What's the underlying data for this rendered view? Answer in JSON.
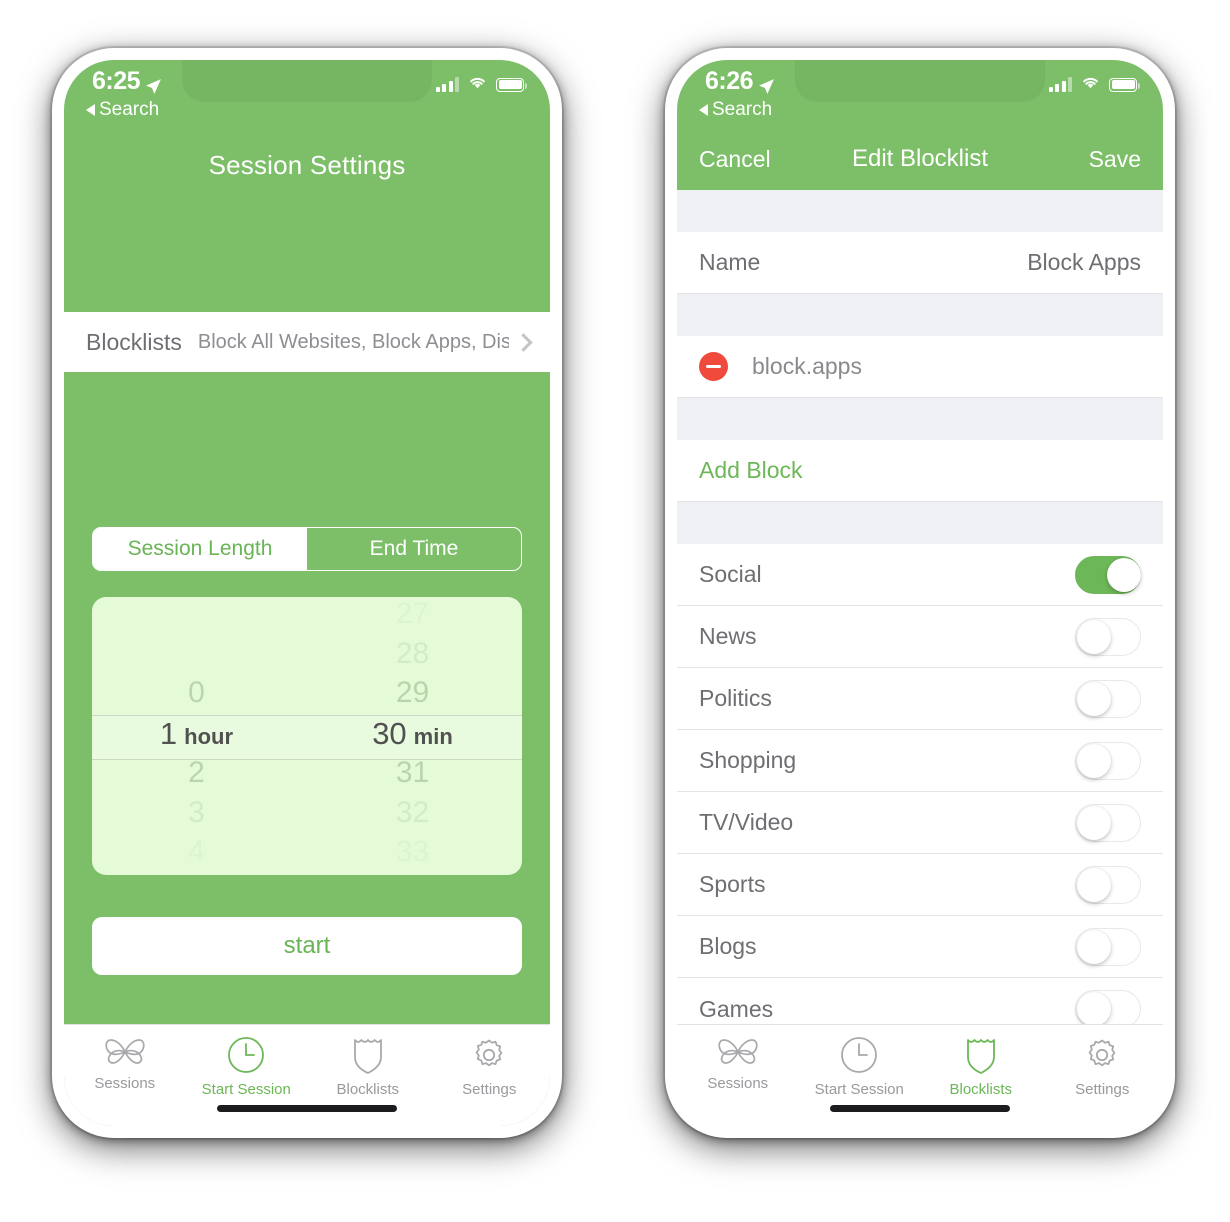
{
  "left_phone": {
    "status_bar": {
      "time": "6:25",
      "back_label": "Search",
      "location_icon": "location-arrow-icon",
      "signal_icon": "cellular-signal-icon",
      "wifi_icon": "wifi-icon",
      "battery_icon": "battery-icon"
    },
    "title": "Session Settings",
    "blocklists_row": {
      "label": "Blocklists",
      "value": "Block All Websites, Block Apps, Distra…",
      "chevron_icon": "chevron-right-icon"
    },
    "segmented_control": {
      "options": [
        "Session Length",
        "End Time"
      ],
      "selected_index": 0
    },
    "picker": {
      "hours": {
        "items": [
          "0",
          "1",
          "2",
          "3",
          "4"
        ],
        "selected": "1",
        "unit": "hour",
        "selected_index": 1
      },
      "minutes": {
        "items": [
          "27",
          "28",
          "29",
          "30",
          "31",
          "32",
          "33"
        ],
        "selected": "30",
        "unit": "min",
        "selected_index": 3
      }
    },
    "start_button": "start",
    "tab_bar": {
      "items": [
        {
          "label": "Sessions",
          "icon": "butterfly-icon",
          "active": false
        },
        {
          "label": "Start Session",
          "icon": "clock-icon",
          "active": true
        },
        {
          "label": "Blocklists",
          "icon": "shield-icon",
          "active": false
        },
        {
          "label": "Settings",
          "icon": "gear-icon",
          "active": false
        }
      ]
    }
  },
  "right_phone": {
    "status_bar": {
      "time": "6:26",
      "back_label": "Search",
      "location_icon": "location-arrow-icon",
      "signal_icon": "cellular-signal-icon",
      "wifi_icon": "wifi-icon",
      "battery_icon": "battery-icon"
    },
    "nav_bar": {
      "cancel": "Cancel",
      "title": "Edit Blocklist",
      "save": "Save"
    },
    "name_row": {
      "label": "Name",
      "value": "Block Apps"
    },
    "block_row": {
      "delete_icon": "minus-circle-icon",
      "name": "block.apps"
    },
    "add_block": "Add Block",
    "category_toggles": [
      {
        "label": "Social",
        "on": true
      },
      {
        "label": "News",
        "on": false
      },
      {
        "label": "Politics",
        "on": false
      },
      {
        "label": "Shopping",
        "on": false
      },
      {
        "label": "TV/Video",
        "on": false
      },
      {
        "label": "Sports",
        "on": false
      },
      {
        "label": "Blogs",
        "on": false
      },
      {
        "label": "Games",
        "on": false
      }
    ],
    "tab_bar": {
      "items": [
        {
          "label": "Sessions",
          "icon": "butterfly-icon",
          "active": false
        },
        {
          "label": "Start Session",
          "icon": "clock-icon",
          "active": false
        },
        {
          "label": "Blocklists",
          "icon": "shield-icon",
          "active": true
        },
        {
          "label": "Settings",
          "icon": "gear-icon",
          "active": false
        }
      ]
    }
  },
  "colors": {
    "brand_green": "#7cbf68",
    "accent_green": "#6cb757",
    "picker_bg": "#e5fbd7",
    "delete_red": "#ef4a3c",
    "section_gray": "#eff0f4"
  }
}
